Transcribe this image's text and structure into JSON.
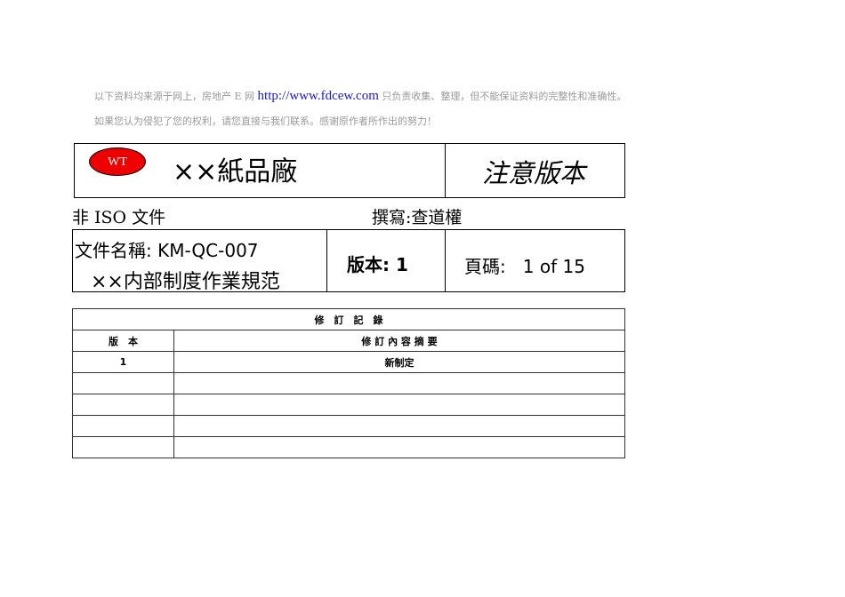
{
  "notice": {
    "line1_pre": "以下资料均来源于网上，房地产 E 网",
    "link": "http://www.fdcew.com",
    "line1_post": "只负责收集、整理，但不能保证资料的完整性和准确性。",
    "line2": "如果您认为侵犯了您的权利，请您直接与我们联系。感谢原作者所作出的努力！"
  },
  "header": {
    "logo": "WT",
    "company": "××紙品廠",
    "stamp": "注意版本"
  },
  "meta": {
    "non_iso": "非 ISO 文件",
    "author": "撰寫:查道權"
  },
  "doc": {
    "name_label": "文件名稱: KM-QC-007",
    "name_title": "××内部制度作業規范",
    "version": "版本: 1",
    "page": "頁碼:   1 of 15"
  },
  "revision": {
    "title": "修　訂　記　錄",
    "col_version": "版　本",
    "col_summary": "修 訂 內 容 摘 要",
    "rows": [
      {
        "version": "1",
        "summary": "新制定"
      },
      {
        "version": "",
        "summary": ""
      },
      {
        "version": "",
        "summary": ""
      },
      {
        "version": "",
        "summary": ""
      },
      {
        "version": "",
        "summary": ""
      }
    ]
  }
}
